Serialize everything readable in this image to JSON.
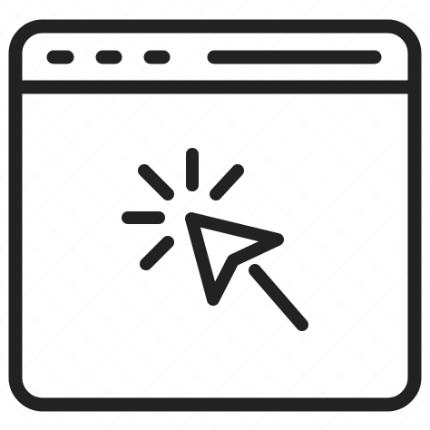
{
  "icon": {
    "name": "browser-window-click-icon",
    "stroke_color": "#222222",
    "background": "#ffffff"
  }
}
